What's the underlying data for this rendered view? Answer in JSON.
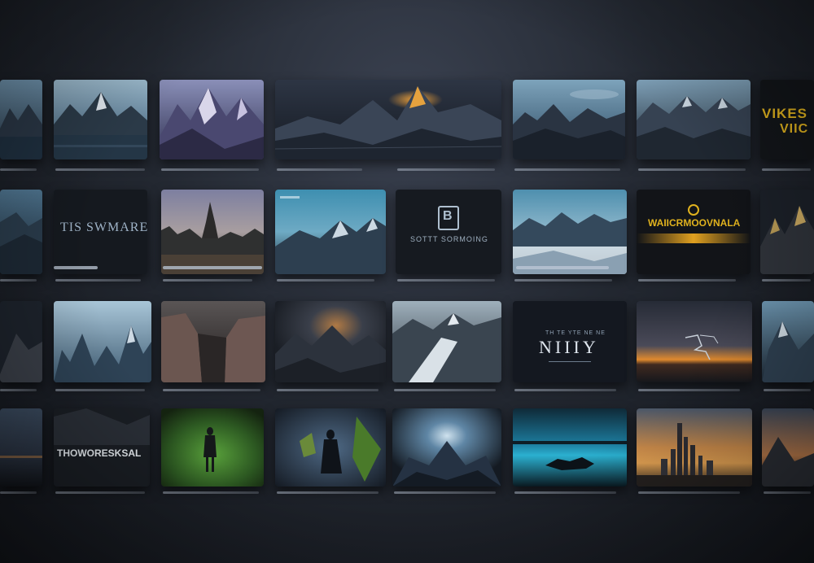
{
  "titles": {
    "yellow_top_1": "VIKES",
    "yellow_top_2": "VIIC",
    "logo_title": "TIS SWMARE",
    "monogram": "B",
    "monogram_caption": "SOTTT SORMOING",
    "yellow_banner": "WAIICRMOOVNALA",
    "niily_small": "TH TE YTE NE NE",
    "niily": "NIIIY",
    "shadow_title": "THOWORESKSAL"
  },
  "colors": {
    "background": "#1c2028",
    "accent_yellow": "#e0b21e",
    "sky_blue": "#5f8fa8",
    "sunset_orange": "#e08a2e"
  }
}
